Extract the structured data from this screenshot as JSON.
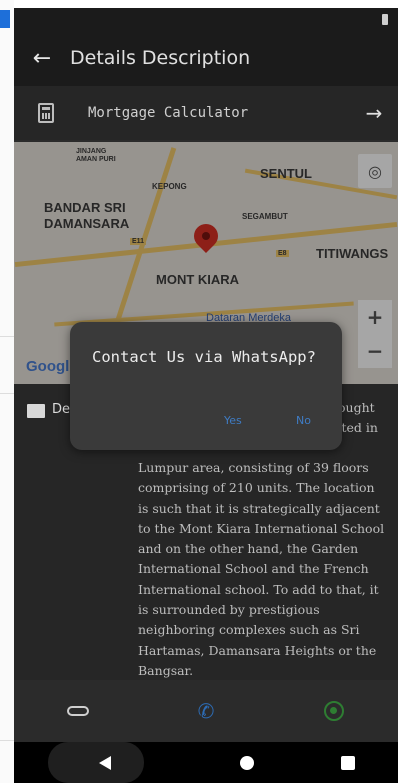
{
  "appbar": {
    "title": "Details Description"
  },
  "mortgage": {
    "label": "Mortgage Calculator"
  },
  "map": {
    "labels": {
      "jinjang": "JINJANG",
      "sentul": "SENTUL",
      "kepong": "KEPONG",
      "bandar_sri": "BANDAR SRI",
      "damansara": "DAMANSARA",
      "segambut": "SEGAMBUT",
      "titiwangsa": "TITIWANGS",
      "mont_kiara": "MONT KIARA",
      "dataran": "Dataran Merdeka",
      "google": "Google",
      "amanpuri": "AMAN PURI",
      "road_e11": "E11",
      "road_e8": "E8"
    },
    "zoom_in": "+",
    "zoom_out": "−"
  },
  "description": {
    "label": "De",
    "text": "Lumpur area, consisting of 39 floors comprising of 210 units. The location is such that it is strategically adjacent to the Mont Kiara International School and on the other hand, the Garden International School and the French International school. To add to that, it is surrounded by prestigious neighboring complexes such as Sri Hartamas, Damansara Heights or the Bangsar.",
    "partial_right_1": "ought",
    "partial_right_2": "ated in"
  },
  "dialog": {
    "title": "Contact Us via WhatsApp?",
    "yes": "Yes",
    "no": "No"
  },
  "colors": {
    "accent": "#3f7cc4",
    "whatsapp": "#2e7d32",
    "pin": "#d93025"
  }
}
